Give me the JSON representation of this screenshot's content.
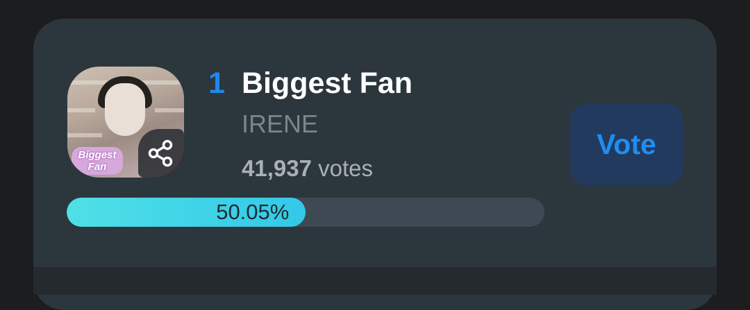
{
  "entry": {
    "rank": "1",
    "title": "Biggest Fan",
    "artist": "IRENE",
    "votes_number": "41,937",
    "votes_suffix": " votes",
    "thumbnail_sticker": "Biggest Fan",
    "share_icon": "share-icon"
  },
  "vote_button": {
    "label": "Vote"
  },
  "progress": {
    "percent": 50.05,
    "label": "50.05%"
  },
  "colors": {
    "accent": "#1e88f0",
    "card_bg": "#2c363d",
    "vote_bg": "#223a5e",
    "progress_fill": "#4fe0e6",
    "progress_track": "#3f4954"
  }
}
